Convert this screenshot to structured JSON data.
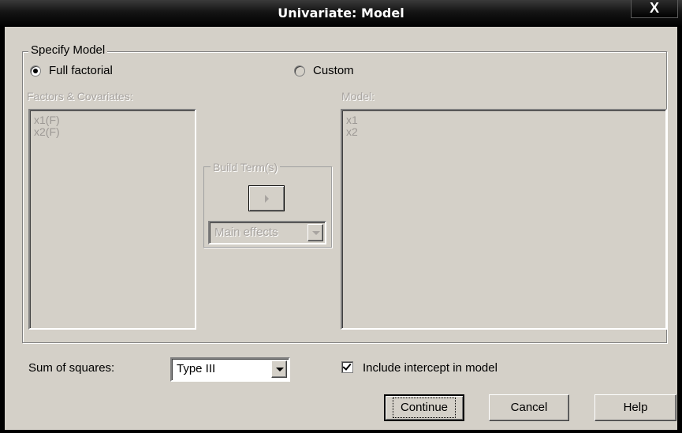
{
  "window": {
    "title": "Univariate: Model",
    "close_label": "X"
  },
  "specify_model": {
    "legend": "Specify Model",
    "full_factorial_label": "Full factorial",
    "custom_label": "Custom",
    "selected": "Full factorial"
  },
  "factors_covariates": {
    "label": "Factors & Covariates:",
    "items": [
      "x1(F)",
      "x2(F)"
    ]
  },
  "model": {
    "label": "Model:",
    "items": [
      "x1",
      "x2"
    ]
  },
  "build_terms": {
    "legend": "Build Term(s)",
    "type_value": "Main effects"
  },
  "sum_of_squares": {
    "label": "Sum of squares:",
    "value": "Type III"
  },
  "include_intercept": {
    "label": "Include intercept in model",
    "checked": true
  },
  "buttons": {
    "continue": "Continue",
    "cancel": "Cancel",
    "help": "Help"
  }
}
